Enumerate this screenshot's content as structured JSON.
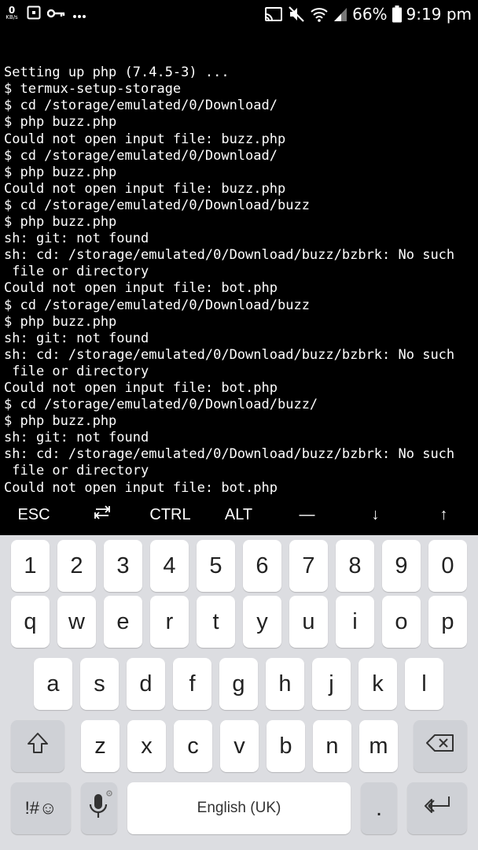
{
  "status_bar": {
    "speed_value": "0",
    "speed_unit": "KB/s",
    "battery": "66%",
    "time": "9:19 pm",
    "left_icons": [
      "screenshot-icon",
      "key-icon",
      "more-icon"
    ],
    "right_icons": [
      "cast-icon",
      "mute-icon",
      "wifi-icon",
      "signal-icon",
      "battery-icon"
    ]
  },
  "terminal": {
    "lines": [
      "Setting up php (7.4.5-3) ...",
      "$ termux-setup-storage",
      "$ cd /storage/emulated/0/Download/",
      "$ php buzz.php",
      "Could not open input file: buzz.php",
      "$ cd /storage/emulated/0/Download/",
      "$ php buzz.php",
      "Could not open input file: buzz.php",
      "$ cd /storage/emulated/0/Download/buzz",
      "$ php buzz.php",
      "sh: git: not found",
      "sh: cd: /storage/emulated/0/Download/buzz/bzbrk: No such",
      " file or directory",
      "Could not open input file: bot.php",
      "$ cd /storage/emulated/0/Download/buzz",
      "$ php buzz.php",
      "sh: git: not found",
      "sh: cd: /storage/emulated/0/Download/buzz/bzbrk: No such",
      " file or directory",
      "Could not open input file: bot.php",
      "$ cd /storage/emulated/0/Download/buzz/",
      "$ php buzz.php",
      "sh: git: not found",
      "sh: cd: /storage/emulated/0/Download/buzz/bzbrk: No such",
      " file or directory",
      "Could not open input file: bot.php"
    ],
    "prompt": "$"
  },
  "extra_keys": {
    "esc": "ESC",
    "tab": "⇄",
    "ctrl": "CTRL",
    "alt": "ALT",
    "dash": "—",
    "down": "↓",
    "up": "↑"
  },
  "keyboard": {
    "numbers": [
      "1",
      "2",
      "3",
      "4",
      "5",
      "6",
      "7",
      "8",
      "9",
      "0"
    ],
    "row1": [
      "q",
      "w",
      "e",
      "r",
      "t",
      "y",
      "u",
      "i",
      "o",
      "p"
    ],
    "row2": [
      "a",
      "s",
      "d",
      "f",
      "g",
      "h",
      "j",
      "k",
      "l"
    ],
    "row3": [
      "z",
      "x",
      "c",
      "v",
      "b",
      "n",
      "m"
    ],
    "symbols_label": "!#☺",
    "space_label": "English (UK)",
    "period": "."
  },
  "colors": {
    "terminal_bg": "#000000",
    "terminal_fg": "#ffffff",
    "keyboard_bg": "#dcdde1",
    "key_bg": "#ffffff",
    "func_key_bg": "#cfd1d6"
  }
}
